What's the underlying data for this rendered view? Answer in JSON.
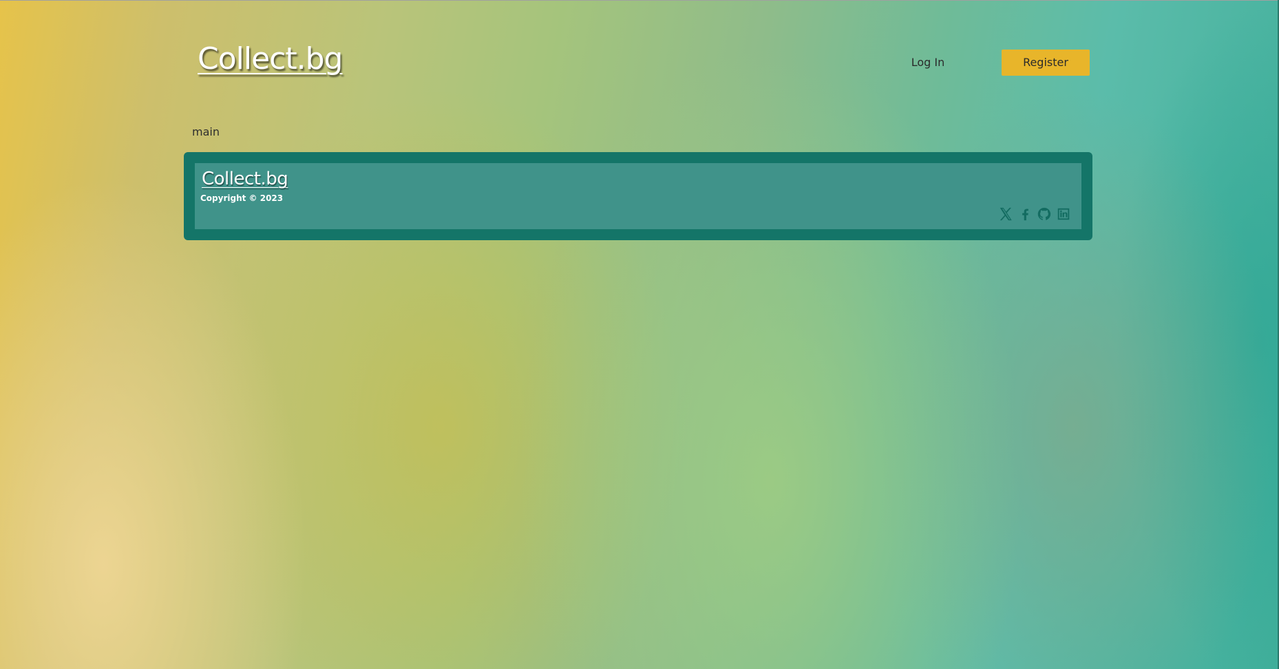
{
  "header": {
    "logo_text": "Collect.bg",
    "login_label": "Log In",
    "register_label": "Register"
  },
  "main": {
    "label": "main"
  },
  "footer": {
    "logo_text": "Collect.bg",
    "copyright": "Copyright © 2023",
    "social_icons": [
      "x-icon",
      "facebook-icon",
      "github-icon",
      "linkedin-icon"
    ]
  },
  "colors": {
    "accent_button": "#e8b52a",
    "footer_border": "#147568",
    "footer_fill": "#40938a",
    "icon_color": "#136c61"
  }
}
